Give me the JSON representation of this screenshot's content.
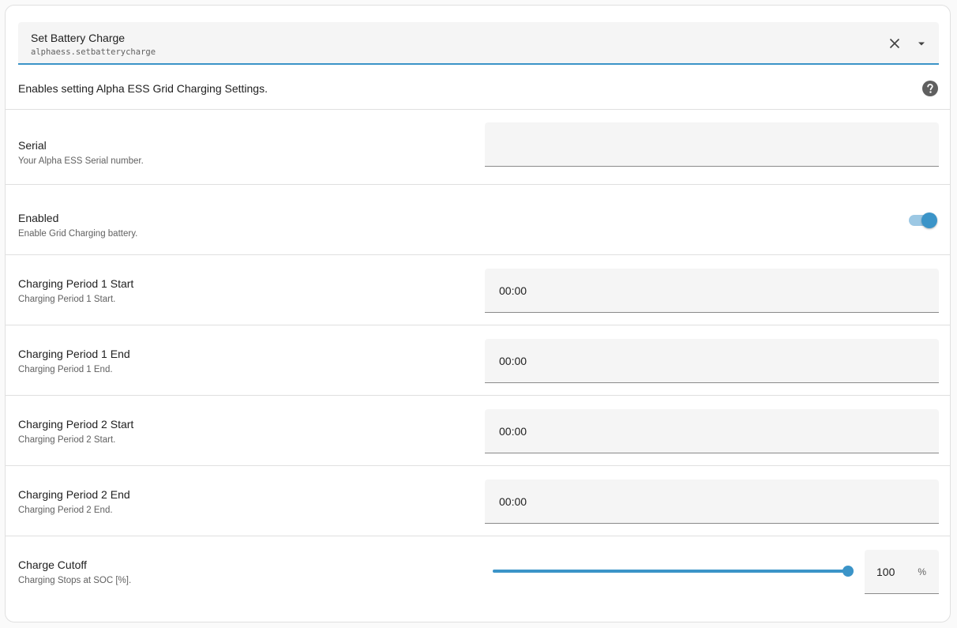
{
  "service": {
    "name": "Set Battery Charge",
    "id": "alphaess.setbatterycharge",
    "description": "Enables setting Alpha ESS Grid Charging Settings.",
    "accent_color": "#3b94c8"
  },
  "fields": {
    "serial": {
      "label": "Serial",
      "description": "Your Alpha ESS Serial number.",
      "value": ""
    },
    "enabled": {
      "label": "Enabled",
      "description": "Enable Grid Charging battery.",
      "checked": true
    },
    "period1_start": {
      "label": "Charging Period 1 Start",
      "description": "Charging Period 1 Start.",
      "value": "00:00"
    },
    "period1_end": {
      "label": "Charging Period 1 End",
      "description": "Charging Period 1 End.",
      "value": "00:00"
    },
    "period2_start": {
      "label": "Charging Period 2 Start",
      "description": "Charging Period 2 Start.",
      "value": "00:00"
    },
    "period2_end": {
      "label": "Charging Period 2 End",
      "description": "Charging Period 2 End.",
      "value": "00:00"
    },
    "charge_cutoff": {
      "label": "Charge Cutoff",
      "description": "Charging Stops at SOC [%].",
      "value": "100",
      "unit": "%",
      "min": 0,
      "max": 100
    }
  },
  "icons": {
    "clear": "close-icon",
    "dropdown": "menu-down-icon",
    "help": "help-circle-icon"
  }
}
